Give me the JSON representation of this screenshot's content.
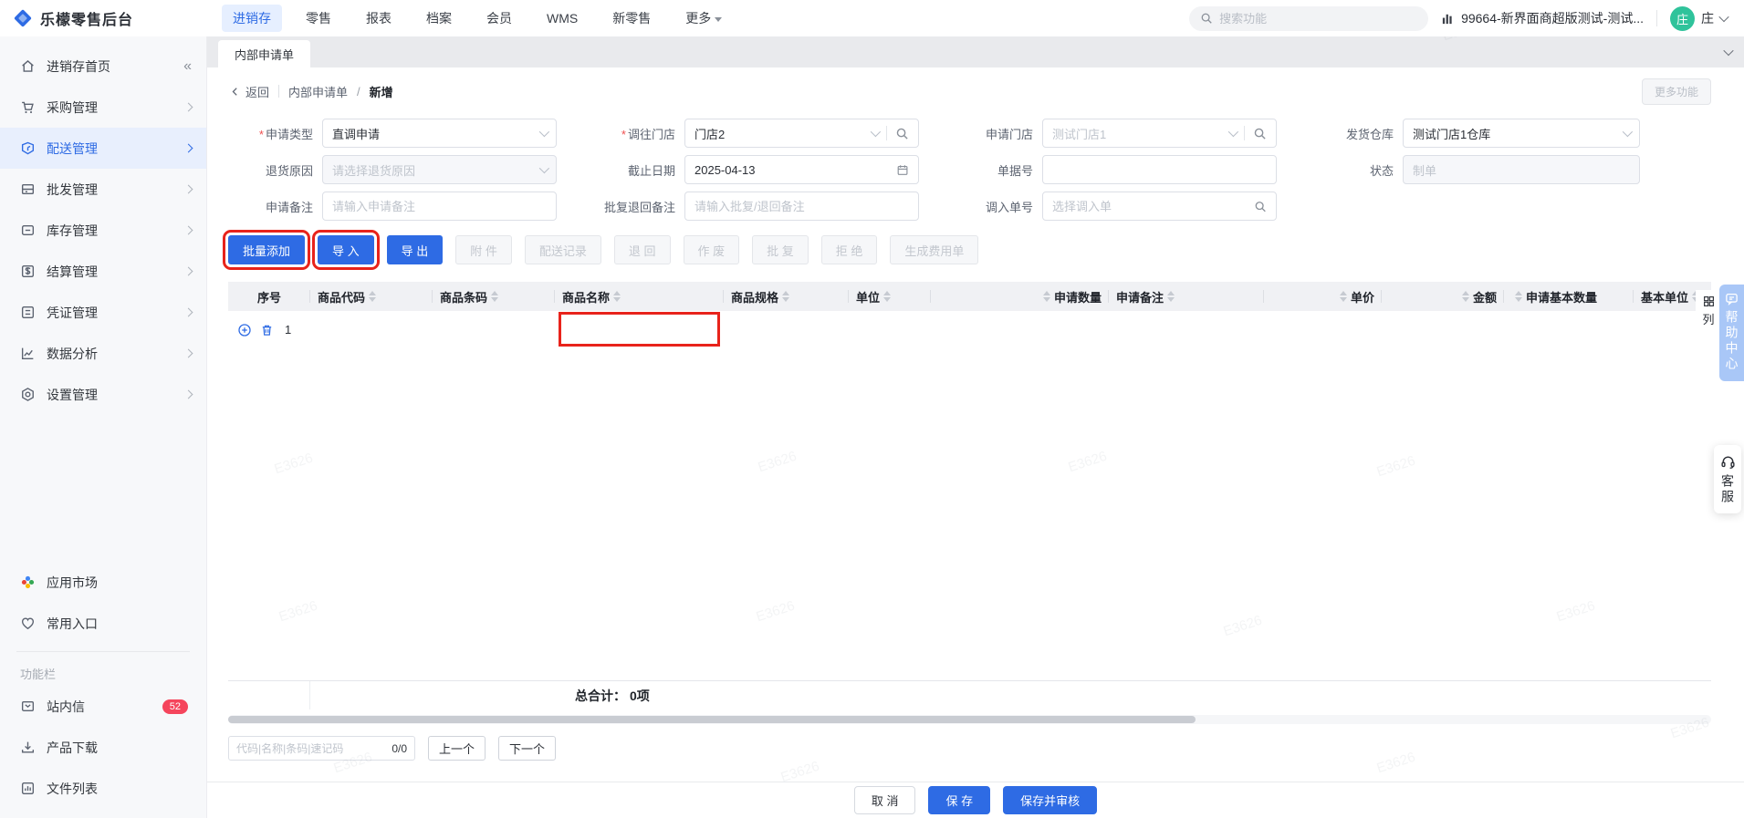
{
  "watermark": {
    "text": "E3626"
  },
  "topnav": {
    "brand": "乐檬零售后台",
    "items": [
      {
        "label": "进销存",
        "active": true
      },
      {
        "label": "零售"
      },
      {
        "label": "报表"
      },
      {
        "label": "档案"
      },
      {
        "label": "会员"
      },
      {
        "label": "WMS"
      },
      {
        "label": "新零售"
      },
      {
        "label": "更多"
      }
    ],
    "search_placeholder": "搜索功能",
    "tenant": "99664-新界面商超版测试-测试...",
    "user_initial": "庄",
    "user_name": "庄"
  },
  "sidebar": {
    "items": [
      {
        "label": "进销存首页"
      },
      {
        "label": "采购管理"
      },
      {
        "label": "配送管理",
        "active": true
      },
      {
        "label": "批发管理"
      },
      {
        "label": "库存管理"
      },
      {
        "label": "结算管理"
      },
      {
        "label": "凭证管理"
      },
      {
        "label": "数据分析"
      },
      {
        "label": "设置管理"
      }
    ],
    "quick": [
      {
        "label": "应用市场"
      },
      {
        "label": "常用入口"
      }
    ],
    "section_label": "功能栏",
    "tools": [
      {
        "label": "站内信",
        "badge": "52"
      },
      {
        "label": "产品下载"
      },
      {
        "label": "文件列表"
      }
    ]
  },
  "tabbar": {
    "active_tab": "内部申请单"
  },
  "page": {
    "back": "返回",
    "breadcrumb_parent": "内部申请单",
    "breadcrumb_sep": "/",
    "breadcrumb_current": "新增",
    "more_button": "更多功能"
  },
  "form": {
    "fields": {
      "apply_type": {
        "label": "申请类型",
        "value": "直调申请"
      },
      "to_store": {
        "label": "调往门店",
        "value": "门店2"
      },
      "apply_store": {
        "label": "申请门店",
        "value": "测试门店1"
      },
      "ship_warehouse": {
        "label": "发货仓库",
        "value": "测试门店1仓库"
      },
      "return_reason": {
        "label": "退货原因",
        "placeholder": "请选择退货原因"
      },
      "deadline": {
        "label": "截止日期",
        "value": "2025-04-13"
      },
      "doc_no": {
        "label": "单据号",
        "value": ""
      },
      "status": {
        "label": "状态",
        "value": "制单"
      },
      "apply_remark": {
        "label": "申请备注",
        "placeholder": "请输入申请备注"
      },
      "approve_remark": {
        "label": "批复退回备注",
        "placeholder": "请输入批复/退回备注"
      },
      "transfer_in_no": {
        "label": "调入单号",
        "placeholder": "选择调入单"
      }
    }
  },
  "toolbar": {
    "buttons": [
      {
        "label": "批量添加",
        "type": "primary",
        "highlighted": true
      },
      {
        "label": "导 入",
        "type": "primary",
        "highlighted": true
      },
      {
        "label": "导 出",
        "type": "primary"
      },
      {
        "label": "附 件",
        "type": "disabled"
      },
      {
        "label": "配送记录",
        "type": "disabled"
      },
      {
        "label": "退 回",
        "type": "disabled"
      },
      {
        "label": "作 废",
        "type": "disabled"
      },
      {
        "label": "批 复",
        "type": "disabled"
      },
      {
        "label": "拒 绝",
        "type": "disabled"
      },
      {
        "label": "生成费用单",
        "type": "disabled"
      }
    ]
  },
  "table": {
    "columns": [
      {
        "label": "序号"
      },
      {
        "label": "商品代码",
        "sortable": true
      },
      {
        "label": "商品条码",
        "sortable": true
      },
      {
        "label": "商品名称",
        "sortable": true
      },
      {
        "label": "商品规格",
        "sortable": true
      },
      {
        "label": "单位",
        "sortable": true
      },
      {
        "label": "申请数量",
        "sortable": true
      },
      {
        "label": "申请备注",
        "sortable": true
      },
      {
        "label": "单价",
        "sortable": true
      },
      {
        "label": "金额",
        "sortable": true
      },
      {
        "label": "申请基本数量",
        "sortable": true
      },
      {
        "label": "基本单位",
        "sortable": true
      }
    ],
    "rows": [
      {
        "seq": "1"
      }
    ],
    "column_config_label": "列",
    "total_label": "总合计：",
    "total_value": "0项"
  },
  "footer": {
    "quick_search_placeholder": "代码|名称|条码|速记码",
    "counter": "0/0",
    "prev": "上一个",
    "next": "下一个"
  },
  "actions": {
    "cancel": "取 消",
    "save": "保 存",
    "save_audit": "保存并审核"
  },
  "side_widgets": {
    "help": "帮助中心",
    "service": "客服"
  }
}
